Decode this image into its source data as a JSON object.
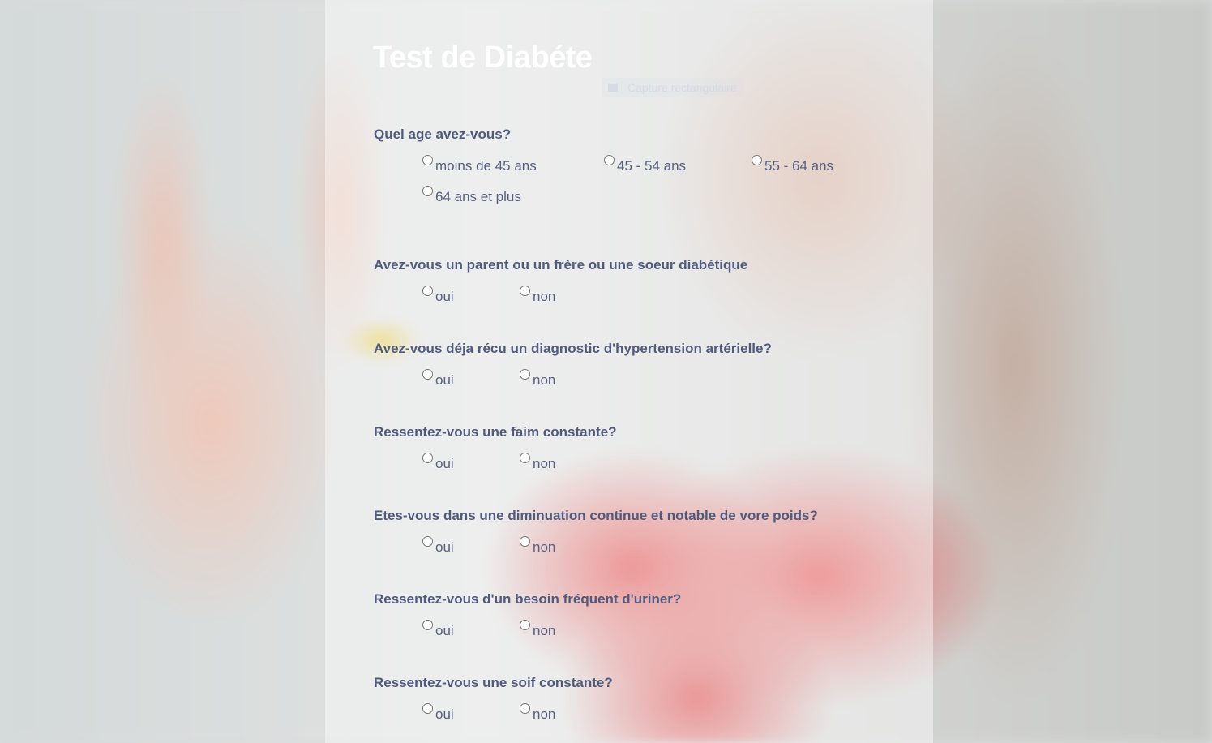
{
  "page": {
    "title": "Test de Diabéte",
    "ghost_caption": "Capture rectangulaire"
  },
  "colors": {
    "title": "#ffffff",
    "question_text": "#4f5a7d",
    "option_text": "#565f80",
    "panel_overlay": "rgba(255,255,255,0.42)"
  },
  "questions": [
    {
      "label": "Quel age avez-vous?",
      "options": [
        "moins de 45 ans",
        "45 - 54 ans",
        "55 - 64 ans",
        "64 ans et plus"
      ],
      "selected": null
    },
    {
      "label": "Avez-vous un parent ou un frère ou une soeur diabétique",
      "options": [
        "oui",
        "non"
      ],
      "selected": null
    },
    {
      "label": "Avez-vous déja récu un diagnostic d'hypertension artérielle?",
      "options": [
        "oui",
        "non"
      ],
      "selected": null
    },
    {
      "label": "Ressentez-vous une faim constante?",
      "options": [
        "oui",
        "non"
      ],
      "selected": null
    },
    {
      "label": "Etes-vous dans une diminuation continue et notable de vore poids?",
      "options": [
        "oui",
        "non"
      ],
      "selected": null
    },
    {
      "label": "Ressentez-vous d'un besoin fréquent d'uriner?",
      "options": [
        "oui",
        "non"
      ],
      "selected": null
    },
    {
      "label": "Ressentez-vous une soif constante?",
      "options": [
        "oui",
        "non"
      ],
      "selected": null
    }
  ]
}
